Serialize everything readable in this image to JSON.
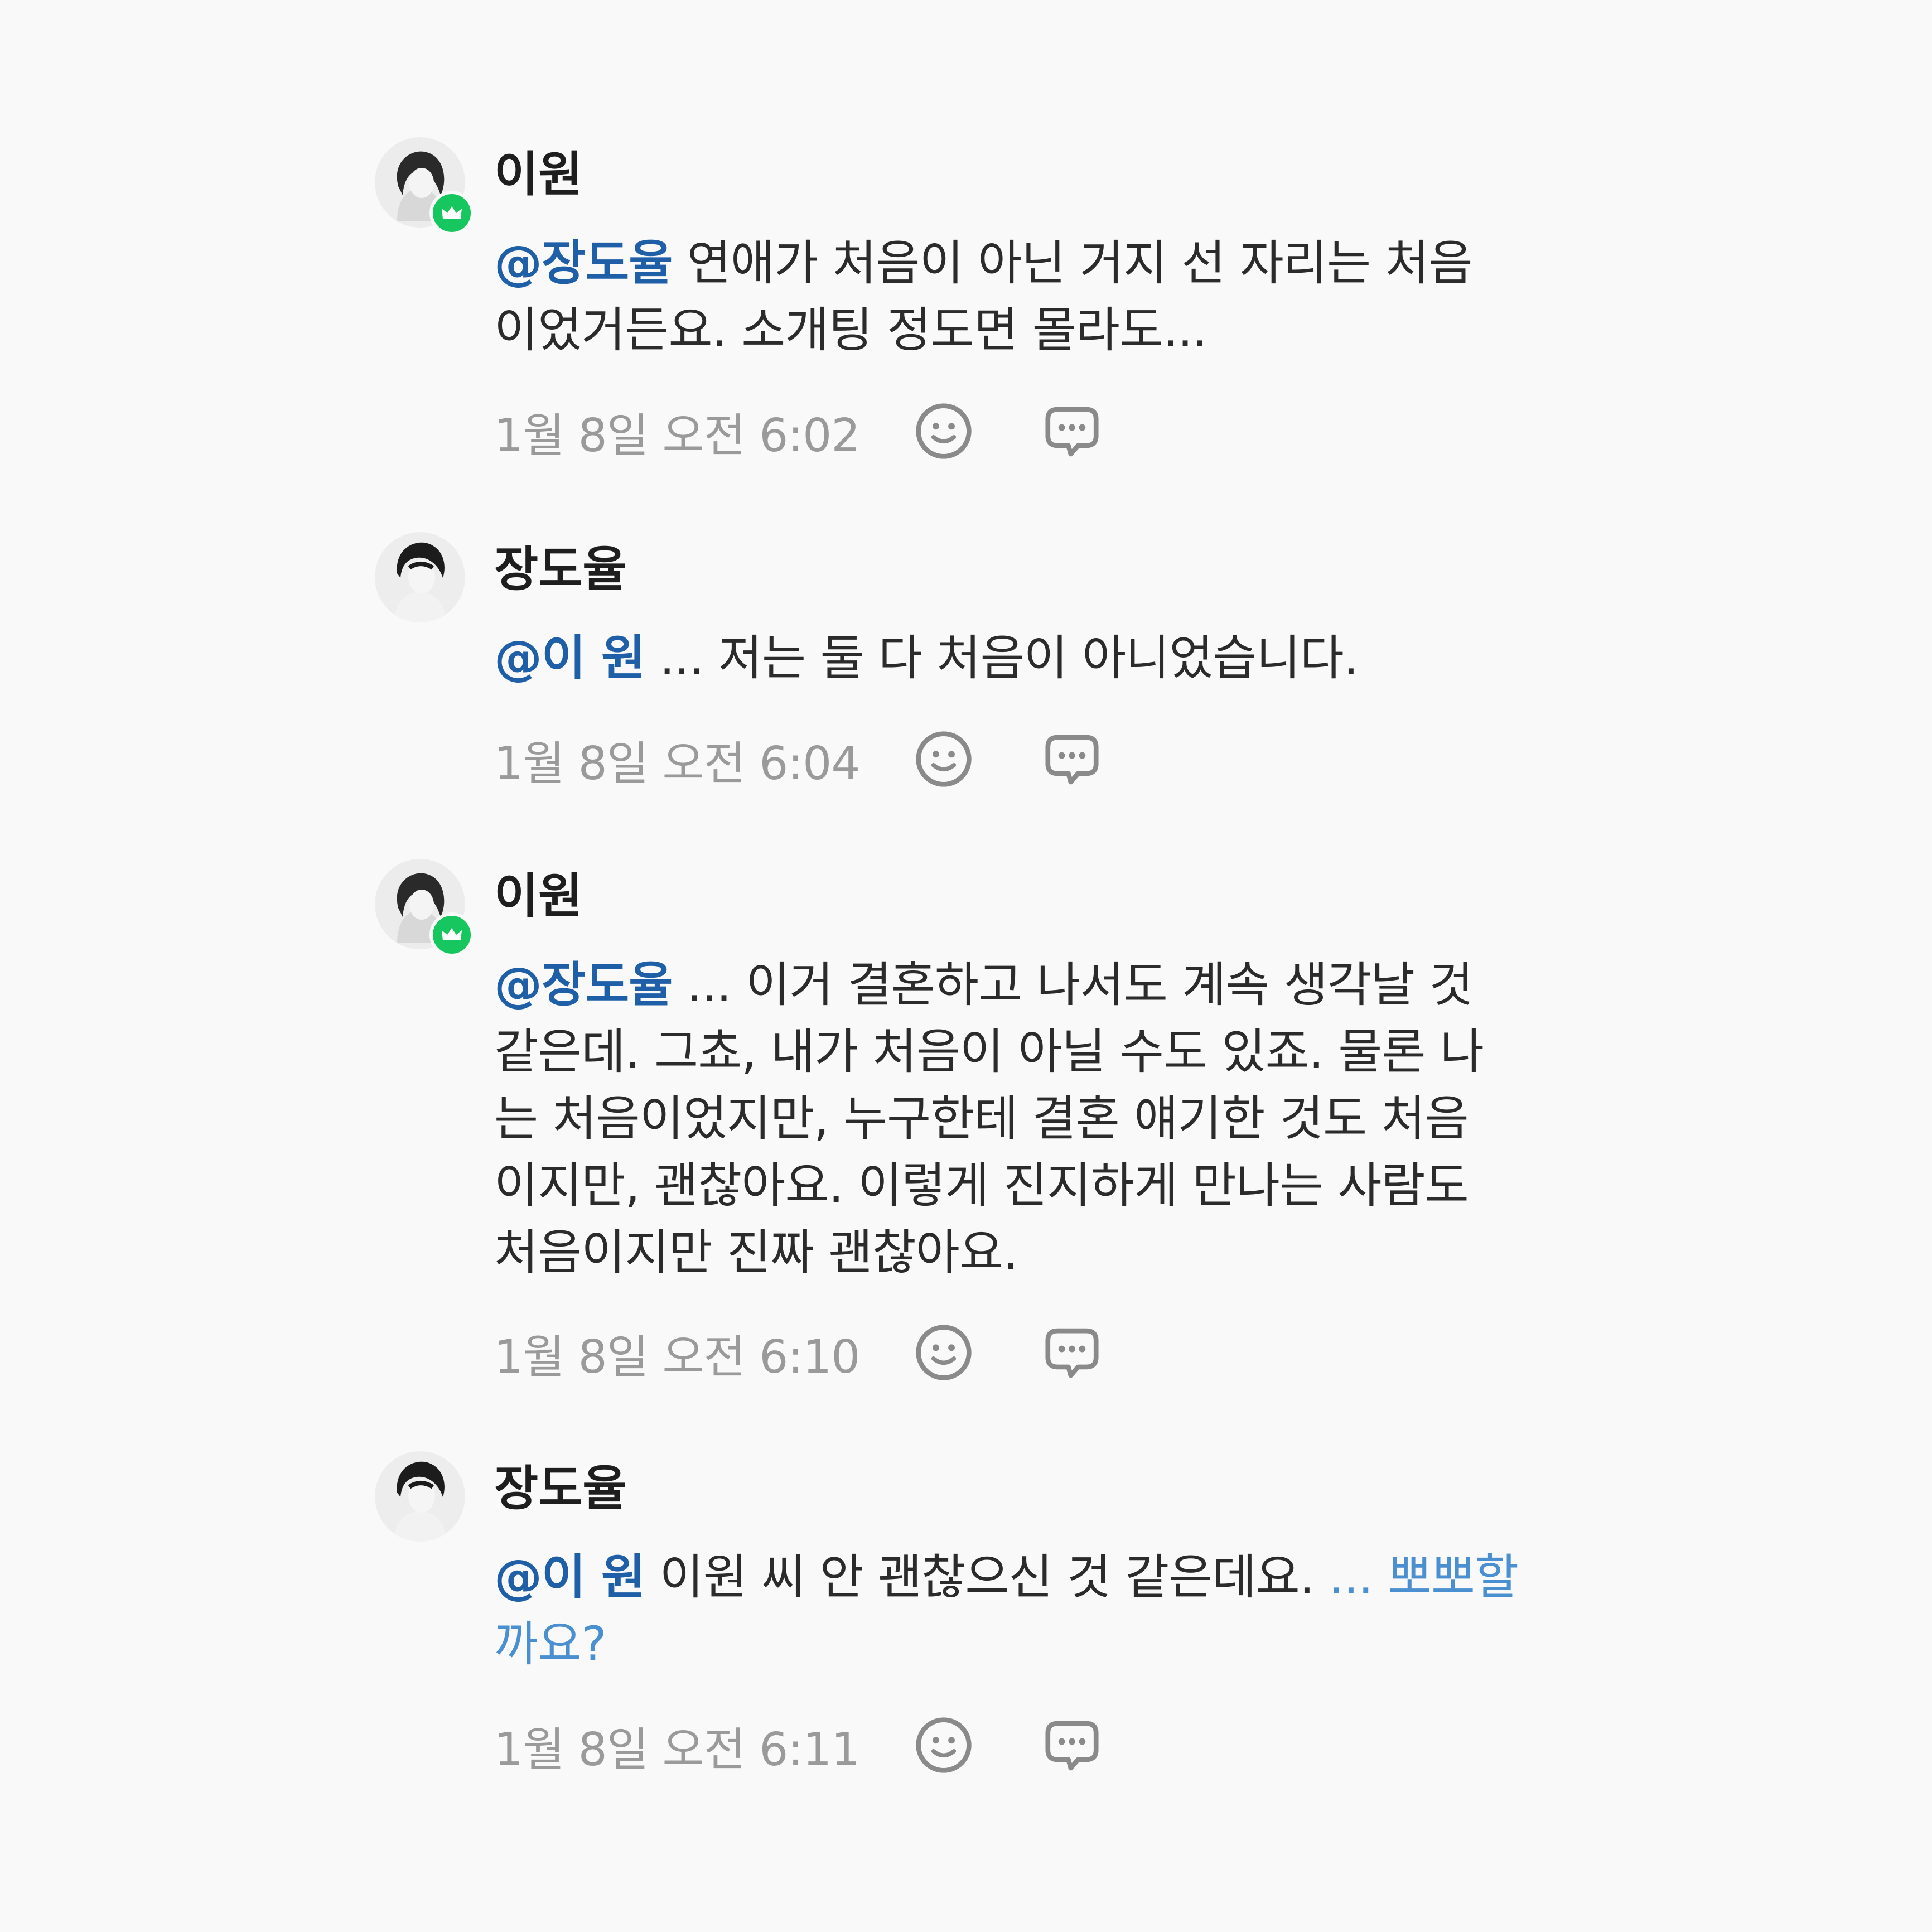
{
  "comments": [
    {
      "author": "이원",
      "role": "host",
      "mention": "@장도율",
      "text_lines": [
        "연애가 처음이 아닌 거지 선 자리는 처음",
        "이었거든요. 소개팅 정도면 몰라도..."
      ],
      "time": "1월 8일 오전 6:02"
    },
    {
      "author": "장도율",
      "role": "member",
      "mention": "@이 원",
      "text_lines": [
        "... 저는 둘 다 처음이 아니었습니다."
      ],
      "time": "1월 8일 오전 6:04"
    },
    {
      "author": "이원",
      "role": "host",
      "mention": "@장도율",
      "text_lines": [
        "... 이거 결혼하고 나서도 계속 생각날 것",
        "같은데. 그쵸, 내가 처음이 아닐 수도 있죠. 물론 나",
        "는 처음이었지만, 누구한테 결혼 얘기한 것도 처음",
        "이지만, 괜찮아요. 이렇게 진지하게 만나는 사람도",
        "처음이지만 진짜 괜찮아요."
      ],
      "time": "1월 8일 오전 6:10"
    },
    {
      "author": "장도율",
      "role": "member",
      "mention": "@이 원",
      "text_lines": [
        "이원 씨 안 괜찮으신 것 같은데요."
      ],
      "more_link": "... 뽀뽀할",
      "more_link_cont": "까요?",
      "time": "1월 8일 오전 6:11"
    }
  ],
  "icons": {
    "host_badge": "crown-icon",
    "reaction": "smiley-icon",
    "reply": "speech-bubble-icon"
  },
  "colors": {
    "background": "#f9f9f9",
    "mention": "#1f5fa8",
    "link": "#4a8fd0",
    "badge": "#16c75f",
    "timestamp": "#9a9a9a"
  }
}
